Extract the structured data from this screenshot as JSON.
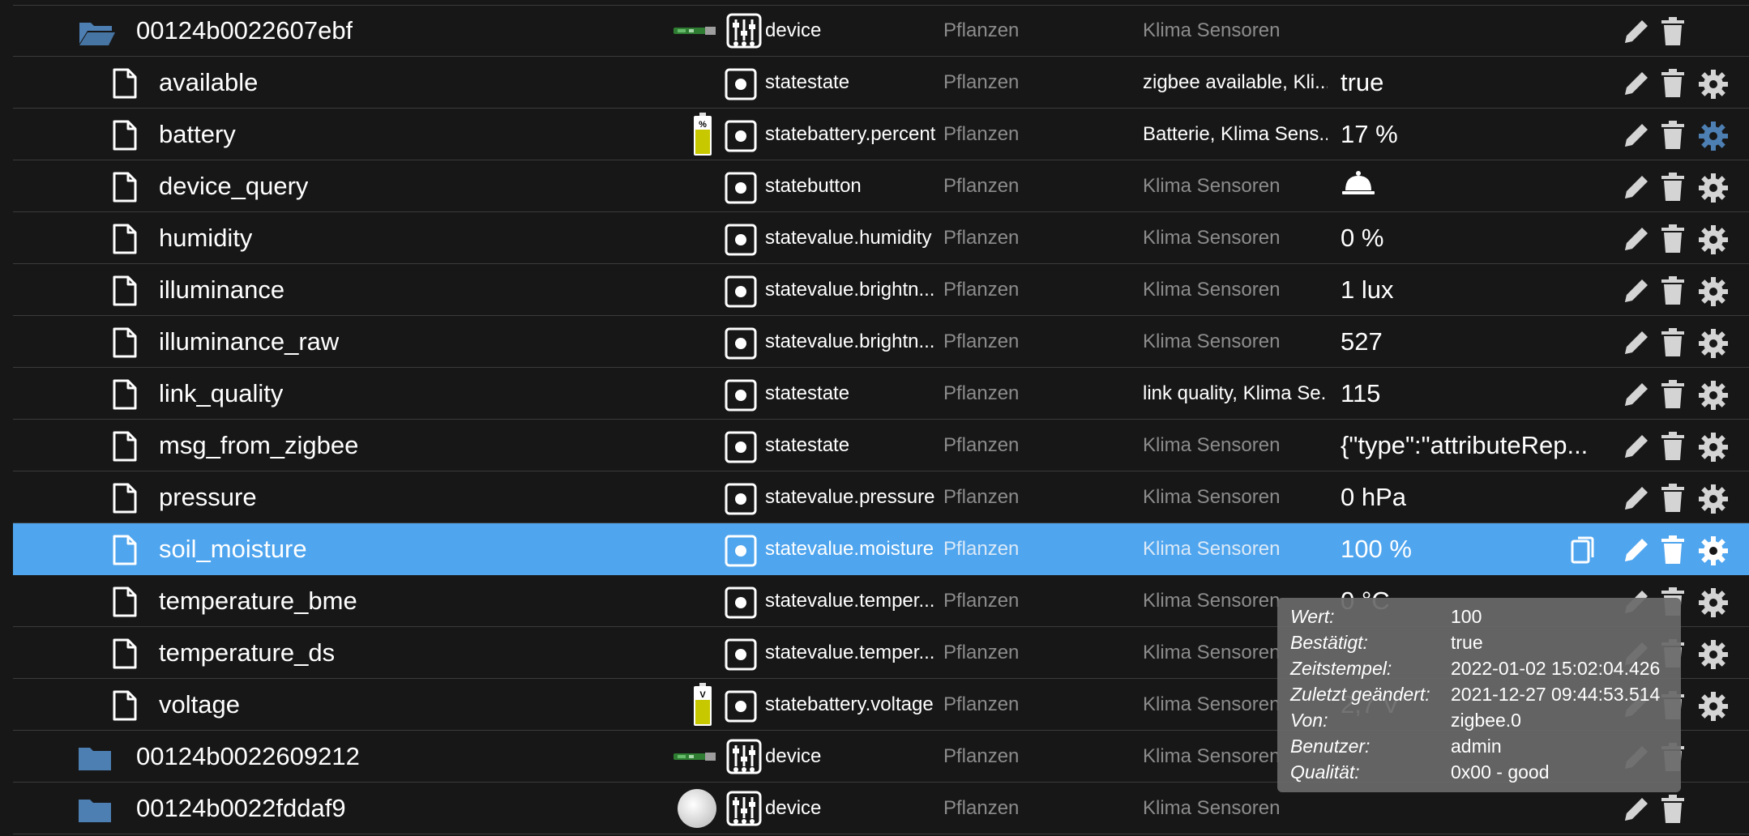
{
  "rows": [
    {
      "kind": "folder",
      "open": true,
      "name": "00124b0022607ebf",
      "device_img": "stick",
      "type_icon": "sliders-icon",
      "role": "device",
      "room": "Pflanzen",
      "function": "Klima Sensoren",
      "function_light": false,
      "value": "",
      "actions": [
        "edit",
        "delete"
      ]
    },
    {
      "kind": "file",
      "name": "available",
      "device_img": "",
      "type_icon": "state-icon",
      "role": "statestate",
      "room": "Pflanzen",
      "function": "zigbee available, Kli...",
      "function_light": true,
      "value": "true",
      "actions": [
        "edit",
        "delete",
        "settings"
      ]
    },
    {
      "kind": "file",
      "name": "battery",
      "device_img": "battery-percent",
      "type_icon": "state-icon",
      "role": "statebattery.percent",
      "room": "Pflanzen",
      "function": "Batterie, Klima Sens...",
      "function_light": true,
      "value": "17 %",
      "actions": [
        "edit",
        "delete",
        "settings"
      ],
      "gear_color": "#4d7fb3"
    },
    {
      "kind": "file",
      "name": "device_query",
      "device_img": "",
      "type_icon": "state-icon",
      "role": "statebutton",
      "room": "Pflanzen",
      "function": "Klima Sensoren",
      "function_light": false,
      "value": "",
      "value_icon": "bell-icon",
      "actions": [
        "edit",
        "delete",
        "settings"
      ]
    },
    {
      "kind": "file",
      "name": "humidity",
      "device_img": "",
      "type_icon": "state-icon",
      "role": "statevalue.humidity",
      "room": "Pflanzen",
      "function": "Klima Sensoren",
      "function_light": false,
      "value": "0 %",
      "actions": [
        "edit",
        "delete",
        "settings"
      ]
    },
    {
      "kind": "file",
      "name": "illuminance",
      "device_img": "",
      "type_icon": "state-icon",
      "role": "statevalue.brightn...",
      "room": "Pflanzen",
      "function": "Klima Sensoren",
      "function_light": false,
      "value": "1 lux",
      "actions": [
        "edit",
        "delete",
        "settings"
      ]
    },
    {
      "kind": "file",
      "name": "illuminance_raw",
      "device_img": "",
      "type_icon": "state-icon",
      "role": "statevalue.brightn...",
      "room": "Pflanzen",
      "function": "Klima Sensoren",
      "function_light": false,
      "value": "527",
      "actions": [
        "edit",
        "delete",
        "settings"
      ]
    },
    {
      "kind": "file",
      "name": "link_quality",
      "device_img": "",
      "type_icon": "state-icon",
      "role": "statestate",
      "room": "Pflanzen",
      "function": "link quality, Klima Se...",
      "function_light": true,
      "value": "115",
      "actions": [
        "edit",
        "delete",
        "settings"
      ]
    },
    {
      "kind": "file",
      "name": "msg_from_zigbee",
      "device_img": "",
      "type_icon": "state-icon",
      "role": "statestate",
      "room": "Pflanzen",
      "function": "Klima Sensoren",
      "function_light": false,
      "value": "{\"type\":\"attributeRep...",
      "actions": [
        "edit",
        "delete",
        "settings"
      ]
    },
    {
      "kind": "file",
      "name": "pressure",
      "device_img": "",
      "type_icon": "state-icon",
      "role": "statevalue.pressure",
      "room": "Pflanzen",
      "function": "Klima Sensoren",
      "function_light": false,
      "value": "0 hPa",
      "actions": [
        "edit",
        "delete",
        "settings"
      ]
    },
    {
      "kind": "file",
      "name": "soil_moisture",
      "selected": true,
      "device_img": "",
      "type_icon": "state-icon",
      "role": "statevalue.moisture",
      "room": "Pflanzen",
      "function": "Klima Sensoren",
      "function_light": false,
      "value": "100 %",
      "actions": [
        "copy",
        "edit",
        "delete",
        "settings"
      ]
    },
    {
      "kind": "file",
      "name": "temperature_bme",
      "device_img": "",
      "type_icon": "state-icon",
      "role": "statevalue.temper...",
      "room": "Pflanzen",
      "function": "Klima Sensoren",
      "function_light": false,
      "value": "0 °C",
      "actions": [
        "edit",
        "delete",
        "settings"
      ]
    },
    {
      "kind": "file",
      "name": "temperature_ds",
      "device_img": "",
      "type_icon": "state-icon",
      "role": "statevalue.temper...",
      "room": "Pflanzen",
      "function": "Klima Sensoren",
      "function_light": false,
      "value": "",
      "actions": [
        "edit",
        "delete",
        "settings"
      ]
    },
    {
      "kind": "file",
      "name": "voltage",
      "device_img": "battery-voltage",
      "type_icon": "state-icon",
      "role": "statebattery.voltage",
      "room": "Pflanzen",
      "function": "Klima Sensoren",
      "function_light": false,
      "value": "2,7 V",
      "actions": [
        "edit",
        "delete",
        "settings"
      ]
    },
    {
      "kind": "folder",
      "open": false,
      "name": "00124b0022609212",
      "device_img": "stick",
      "type_icon": "sliders-icon",
      "role": "device",
      "room": "Pflanzen",
      "function": "Klima Sensoren",
      "function_light": false,
      "value": "",
      "actions": [
        "edit",
        "delete"
      ]
    },
    {
      "kind": "folder",
      "open": false,
      "name": "00124b0022fddaf9",
      "device_img": "round",
      "type_icon": "sliders-icon",
      "role": "device",
      "room": "Pflanzen",
      "function": "Klima Sensoren",
      "function_light": false,
      "value": "",
      "actions": [
        "edit",
        "delete"
      ]
    }
  ],
  "tooltip": [
    {
      "label": "Wert:",
      "value": "100"
    },
    {
      "label": "Bestätigt:",
      "value": "true"
    },
    {
      "label": "Zeitstempel:",
      "value": "2022-01-02 15:02:04.426"
    },
    {
      "label": "Zuletzt geändert:",
      "value": "2021-12-27 09:44:53.514"
    },
    {
      "label": "Von:",
      "value": "zigbee.0"
    },
    {
      "label": "Benutzer:",
      "value": "admin"
    },
    {
      "label": "Qualität:",
      "value": "0x00 - good"
    }
  ],
  "colors": {
    "background": "#171717",
    "selected_row": "#4fa5ee",
    "folder_icon": "#4d7fb3",
    "icon_gray": "#d4d4d4",
    "muted_text": "#8c8c8c",
    "tooltip_bg": "#696969"
  }
}
